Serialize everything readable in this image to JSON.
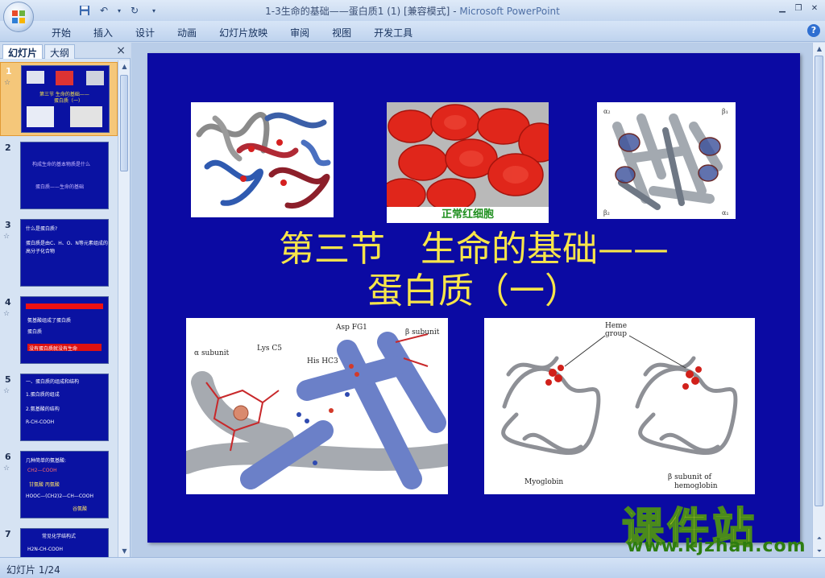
{
  "window": {
    "title": "1-3生命的基础——蛋白质1 (1) [兼容模式]",
    "app_name": "Microsoft PowerPoint",
    "separator": " - "
  },
  "ribbon_tabs": [
    "开始",
    "插入",
    "设计",
    "动画",
    "幻灯片放映",
    "审阅",
    "视图",
    "开发工具"
  ],
  "pane": {
    "tab_slides": "幻灯片",
    "tab_outline": "大纲",
    "close": "×"
  },
  "thumbnails": [
    {
      "num": "1",
      "lines": [
        "第三节 生命的基础——",
        "蛋白质（一）"
      ]
    },
    {
      "num": "2",
      "lines": [
        "构成生命的基本物质是什么",
        "蛋白质——生命的基础"
      ]
    },
    {
      "num": "3",
      "lines": [
        "什么是蛋白质?",
        "蛋白质是由C、H、O、N等元素组成的",
        "高分子化合物"
      ]
    },
    {
      "num": "4",
      "lines": [
        "氨基酸组成了蛋白质",
        "蛋白质",
        "没有蛋白质就没有生命"
      ]
    },
    {
      "num": "5",
      "lines": [
        "一、蛋白质的组成和结构",
        "1.蛋白质的组成",
        "2.氨基酸的结构",
        "R-CH-COOH"
      ]
    },
    {
      "num": "6",
      "lines": [
        "几种简单的氨基酸:",
        "CH2—COOH",
        "甘氨酸   丙氨酸",
        "HOOC—(CH2)2—CH—COOH",
        "谷氨酸"
      ]
    },
    {
      "num": "7",
      "lines": [
        "常见化学结构式",
        "H2N-CH-COOH"
      ]
    }
  ],
  "slide": {
    "title_line1": "第三节　生命的基础——",
    "title_line2": "蛋白质（一）",
    "rbc_caption": "正常红细胞",
    "pic_labels": {
      "alpha_subunit": "α subunit",
      "lys": "Lys C5",
      "asp": "Asp FG1",
      "his": "His HC3",
      "beta_subunit": "β subunit",
      "heme": "Heme",
      "group": "group",
      "myoglobin": "Myoglobin",
      "beta_sub_hemo1": "β subunit of",
      "beta_sub_hemo2": "hemoglobin",
      "a2": "α₂",
      "b1": "β₁",
      "b2": "β₂",
      "a1": "α₁"
    }
  },
  "status": {
    "slide_indicator": "幻灯片 1/24"
  },
  "watermark": {
    "big": "课件站",
    "url": "www.kjzhan.com"
  },
  "colors": {
    "slide_bg": "#0b0aa3",
    "title": "#f7e54a",
    "rbc_caption": "#1f8f1f",
    "selected_thumb": "#f5c77a"
  }
}
